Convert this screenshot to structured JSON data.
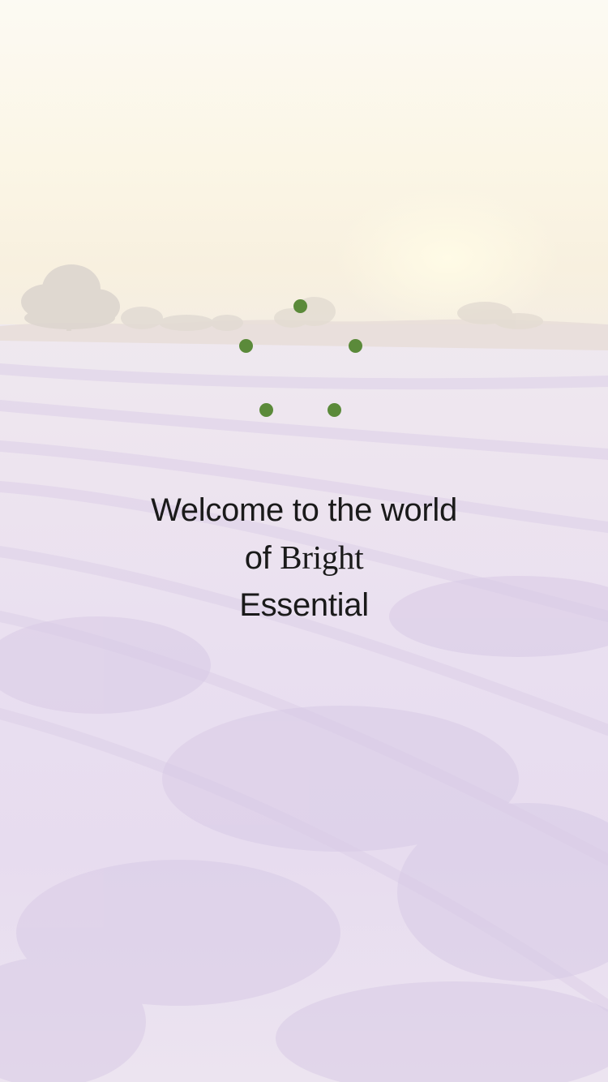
{
  "welcome": {
    "line1": "Welcome to the world",
    "line2_prefix": "of ",
    "brand_name": "Bright",
    "line3": "Essential"
  },
  "loader": {
    "icon": "loading-spinner-icon",
    "color": "#5b8a3a",
    "dot_count": 5
  },
  "background": {
    "scene": "lavender-field-sunrise"
  },
  "colors": {
    "text": "#1a1a1a",
    "accent": "#5b8a3a"
  }
}
